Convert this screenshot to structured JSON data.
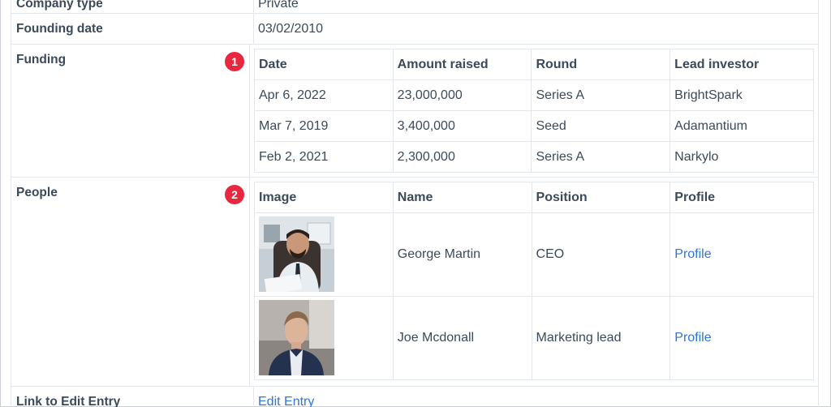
{
  "rows": {
    "company_type": {
      "label": "Company type",
      "value": "Private"
    },
    "founding_date": {
      "label": "Founding date",
      "value": "03/02/2010"
    },
    "funding": {
      "label": "Funding",
      "badge": "1",
      "headers": [
        "Date",
        "Amount raised",
        "Round",
        "Lead investor"
      ],
      "rows": [
        [
          "Apr 6, 2022",
          "23,000,000",
          "Series A",
          "BrightSpark"
        ],
        [
          "Mar 7, 2019",
          "3,400,000",
          "Seed",
          "Adamantium"
        ],
        [
          "Feb 2, 2021",
          "2,300,000",
          "Series A",
          "Narkylo"
        ]
      ]
    },
    "people": {
      "label": "People",
      "badge": "2",
      "headers": [
        "Image",
        "Name",
        "Position",
        "Profile"
      ],
      "rows": [
        {
          "name": "George Martin",
          "position": "CEO",
          "profile": "Profile",
          "image_icon": "portrait-photo-smiling-man"
        },
        {
          "name": "Joe Mcdonall",
          "position": "Marketing lead",
          "profile": "Profile",
          "image_icon": "portrait-photo-young-man"
        }
      ]
    },
    "edit_link": {
      "label": "Link to Edit Entry",
      "value": "Edit Entry"
    }
  },
  "colors": {
    "badge": "#e8283f",
    "link": "#2f74d8",
    "text": "#3b4a5a",
    "border": "#e3e7ec"
  }
}
